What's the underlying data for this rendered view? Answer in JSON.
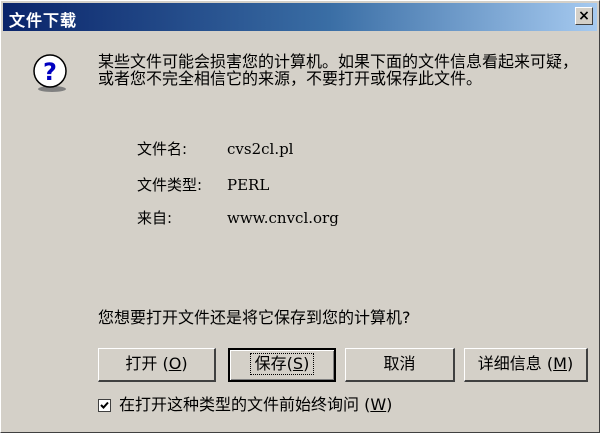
{
  "window": {
    "title": "文件下载",
    "close_glyph": "×"
  },
  "icon": {
    "name": "question-icon",
    "glyph": "?"
  },
  "message": {
    "warning": "某些文件可能会损害您的计算机。如果下面的文件信息看起来可疑，或者您不完全相信它的来源，不要打开或保存此文件。"
  },
  "file_info": {
    "name_label": "文件名:",
    "name_value": "cvs2cl.pl",
    "type_label": "文件类型:",
    "type_value": "PERL",
    "from_label": "来自:",
    "from_value": "www.cnvcl.org"
  },
  "prompt": {
    "question": "您想要打开文件还是将它保存到您的计算机?"
  },
  "buttons": {
    "open": {
      "label": "打开",
      "mnemonic": "O"
    },
    "save": {
      "label": "保存",
      "mnemonic": "S"
    },
    "cancel": {
      "label": "取消"
    },
    "details": {
      "label": "详细信息",
      "mnemonic": "M"
    }
  },
  "checkbox": {
    "label": "在打开这种类型的文件前始终询问",
    "mnemonic": "W",
    "checked": true
  }
}
